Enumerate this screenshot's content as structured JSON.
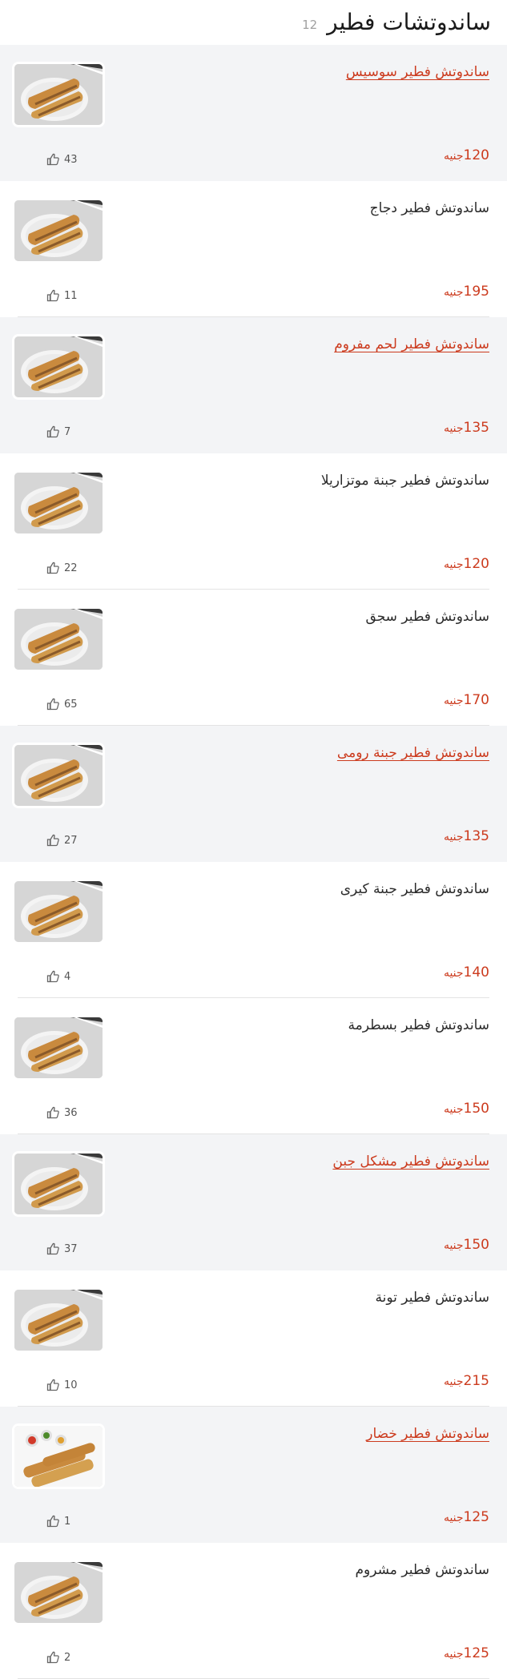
{
  "header": {
    "title": "ساندوتشات فطير",
    "count": "12"
  },
  "currency": "جنيه",
  "items": [
    {
      "name": "ساندوتش فطير سوسيس",
      "price": "120",
      "likes": "43",
      "highlight": true,
      "image": "feteer-sandwich-plate"
    },
    {
      "name": "ساندوتش فطير دجاج",
      "price": "195",
      "likes": "11",
      "highlight": false,
      "image": "feteer-sandwich-plate"
    },
    {
      "name": "ساندوتش فطير لحم مفروم",
      "price": "135",
      "likes": "7",
      "highlight": true,
      "image": "feteer-sandwich-plate"
    },
    {
      "name": "ساندوتش فطير جبنة موتزاريلا",
      "price": "120",
      "likes": "22",
      "highlight": false,
      "image": "feteer-sandwich-plate"
    },
    {
      "name": "ساندوتش فطير سجق",
      "price": "170",
      "likes": "65",
      "highlight": false,
      "image": "feteer-sandwich-plate"
    },
    {
      "name": "ساندوتش فطير جبنة رومى",
      "price": "135",
      "likes": "27",
      "highlight": true,
      "image": "feteer-sandwich-plate"
    },
    {
      "name": "ساندوتش فطير جبنة كيرى",
      "price": "140",
      "likes": "4",
      "highlight": false,
      "image": "feteer-sandwich-plate"
    },
    {
      "name": "ساندوتش فطير بسطرمة",
      "price": "150",
      "likes": "36",
      "highlight": false,
      "image": "feteer-sandwich-plate"
    },
    {
      "name": "ساندوتش فطير مشكل جبن",
      "price": "150",
      "likes": "37",
      "highlight": true,
      "image": "feteer-sandwich-plate"
    },
    {
      "name": "ساندوتش فطير تونة",
      "price": "215",
      "likes": "10",
      "highlight": false,
      "image": "feteer-sandwich-plate"
    },
    {
      "name": "ساندوتش فطير خضار",
      "price": "125",
      "likes": "1",
      "highlight": true,
      "image": "feteer-rolls-veggies"
    },
    {
      "name": "ساندوتش فطير مشروم",
      "price": "125",
      "likes": "2",
      "highlight": false,
      "image": "feteer-sandwich-plate"
    }
  ]
}
